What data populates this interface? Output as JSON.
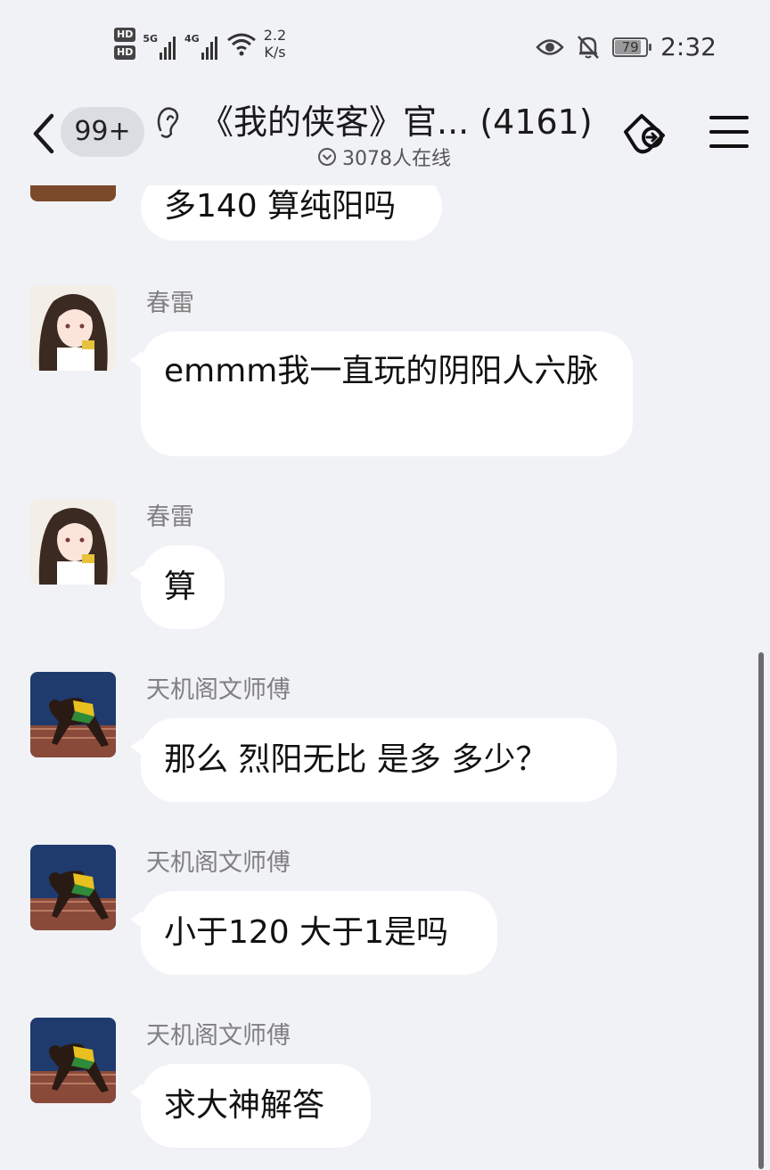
{
  "status_bar": {
    "hd1": "HD",
    "hd2": "HD",
    "net1": "5G",
    "net2": "4G",
    "speed_value": "2.2",
    "speed_unit": "K/s",
    "battery": "79",
    "time": "2:32"
  },
  "header": {
    "unread_count": "99+",
    "title": "《我的侠客》官... (4161)",
    "online_text": "3078人在线"
  },
  "messages": [
    {
      "name": "",
      "text": "多140 算纯阳吗"
    },
    {
      "name": "春雷",
      "text": "emmm我一直玩的阴阳人六脉"
    },
    {
      "name": "春雷",
      "text": "算"
    },
    {
      "name": "天机阁文师傅",
      "text": "那么 烈阳无比 是多 多少？"
    },
    {
      "name": "天机阁文师傅",
      "text": "小于120 大于1是吗"
    },
    {
      "name": "天机阁文师傅",
      "text": "求大神解答"
    }
  ],
  "colors": {
    "background": "#f1f2f6",
    "bubble": "#ffffff",
    "name": "#808080"
  }
}
